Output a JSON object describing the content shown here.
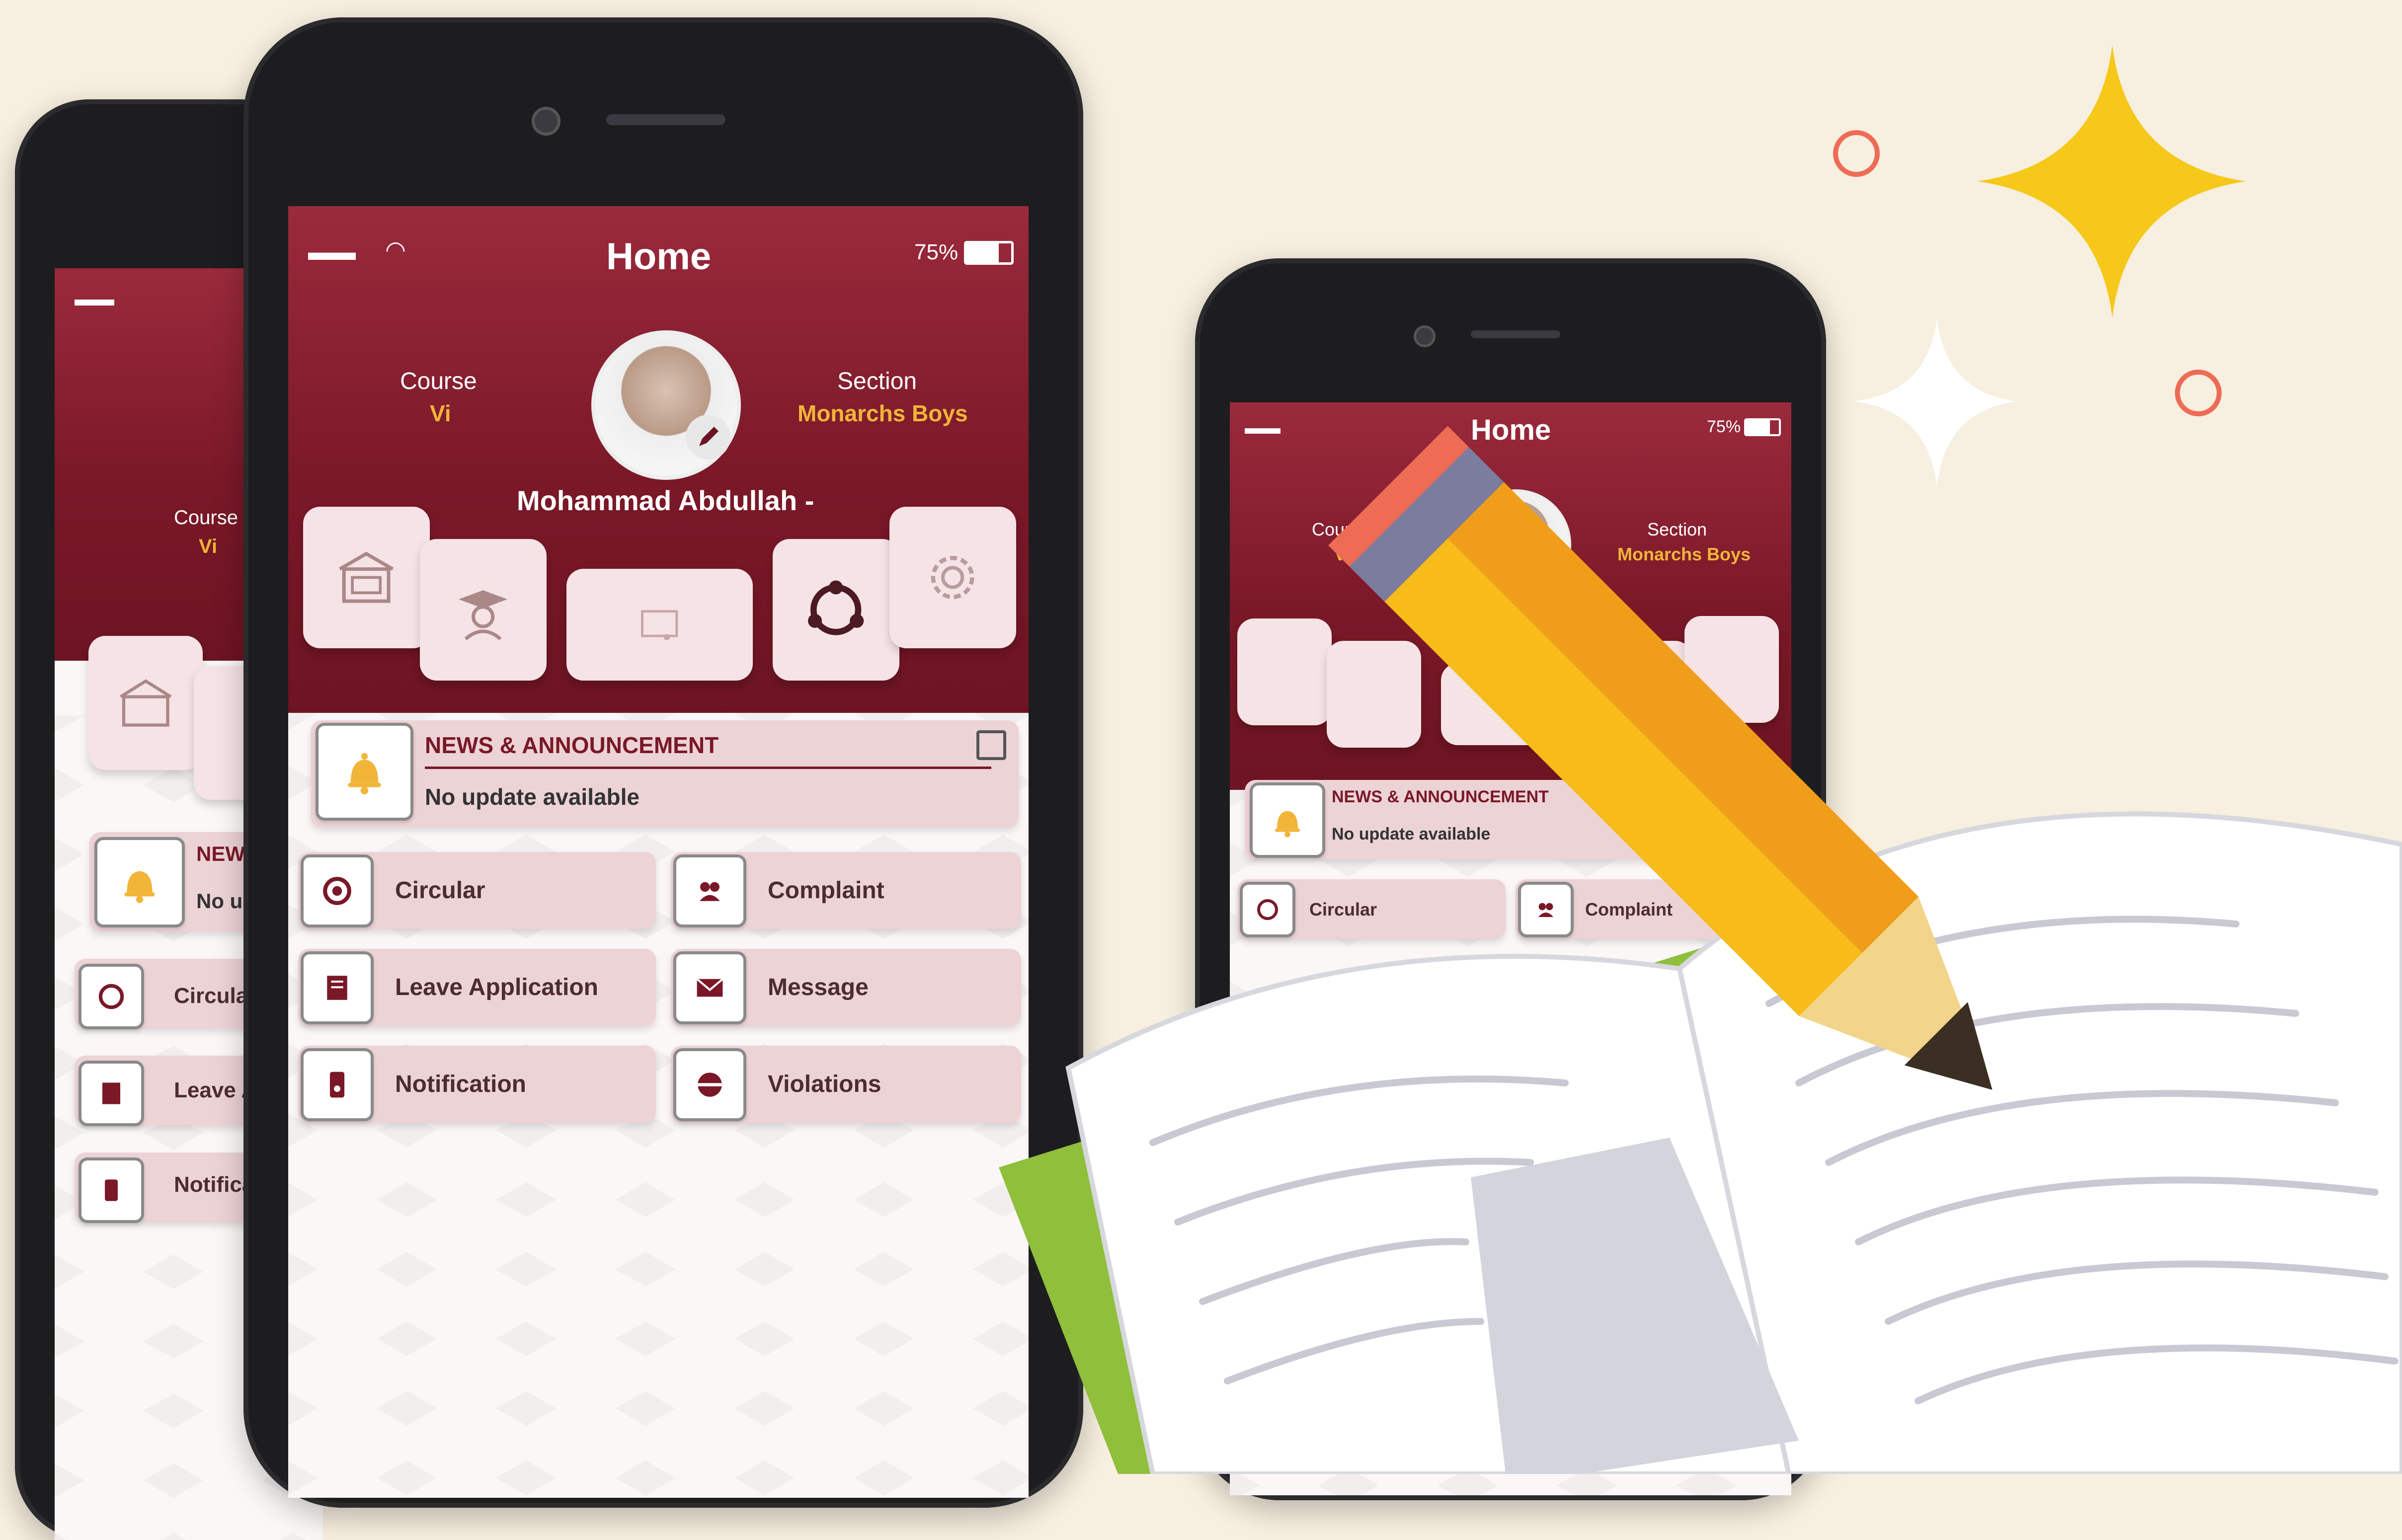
{
  "colors": {
    "background": "#f7efdf",
    "header": "#7a1828",
    "gold": "#f1b53a",
    "tile": "#f6e3e6",
    "card": "#ecd3d6"
  },
  "app": {
    "status": {
      "battery": "75%"
    },
    "title": "Home",
    "course_label": "Course",
    "course_value": "Vi",
    "section_label": "Section",
    "section_value": "Monarchs Boys",
    "student_name": "Mohammad Abdullah -",
    "news_title": "NEWS & ANNOUNCEMENT",
    "news_body": "No update available",
    "menu": {
      "circular": "Circular",
      "complaint": "Complaint",
      "leave": "Leave Application",
      "message": "Message",
      "notification": "Notification",
      "violations": "Violations"
    },
    "back_phone": {
      "news": "NEWS",
      "no_update": "No up",
      "circular": "Circular",
      "leave": "Leave A",
      "notification": "Notifica"
    }
  }
}
